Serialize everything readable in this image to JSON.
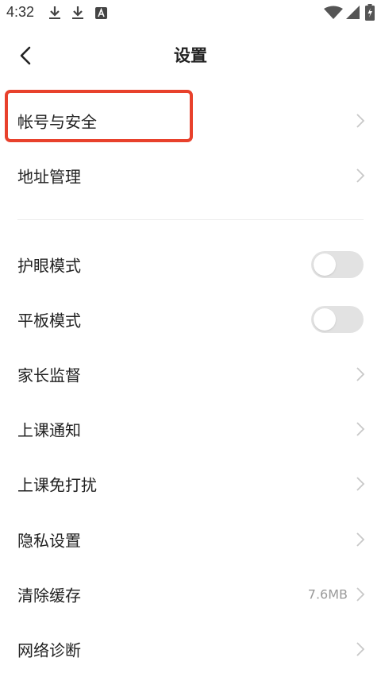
{
  "status_bar": {
    "time": "4:32",
    "icons": [
      "download-icon",
      "download-icon",
      "font-a-icon",
      "wifi-icon",
      "signal-icon",
      "battery-icon"
    ]
  },
  "header": {
    "title": "设置",
    "back_icon": "chevron-left-icon"
  },
  "items": [
    {
      "label": "帐号与安全",
      "type": "link"
    },
    {
      "label": "地址管理",
      "type": "link"
    },
    {
      "label": "护眼模式",
      "type": "toggle",
      "on": false
    },
    {
      "label": "平板模式",
      "type": "toggle",
      "on": false
    },
    {
      "label": "家长监督",
      "type": "link"
    },
    {
      "label": "上课通知",
      "type": "link"
    },
    {
      "label": "上课免打扰",
      "type": "link"
    },
    {
      "label": "隐私设置",
      "type": "link"
    },
    {
      "label": "清除缓存",
      "type": "link",
      "value": "7.6MB"
    },
    {
      "label": "网络诊断",
      "type": "link"
    }
  ],
  "colors": {
    "highlight_border": "#e8412c",
    "toggle_off_track": "#e2e2e2",
    "chevron": "#c8c8c8",
    "secondary_text": "#999999"
  }
}
